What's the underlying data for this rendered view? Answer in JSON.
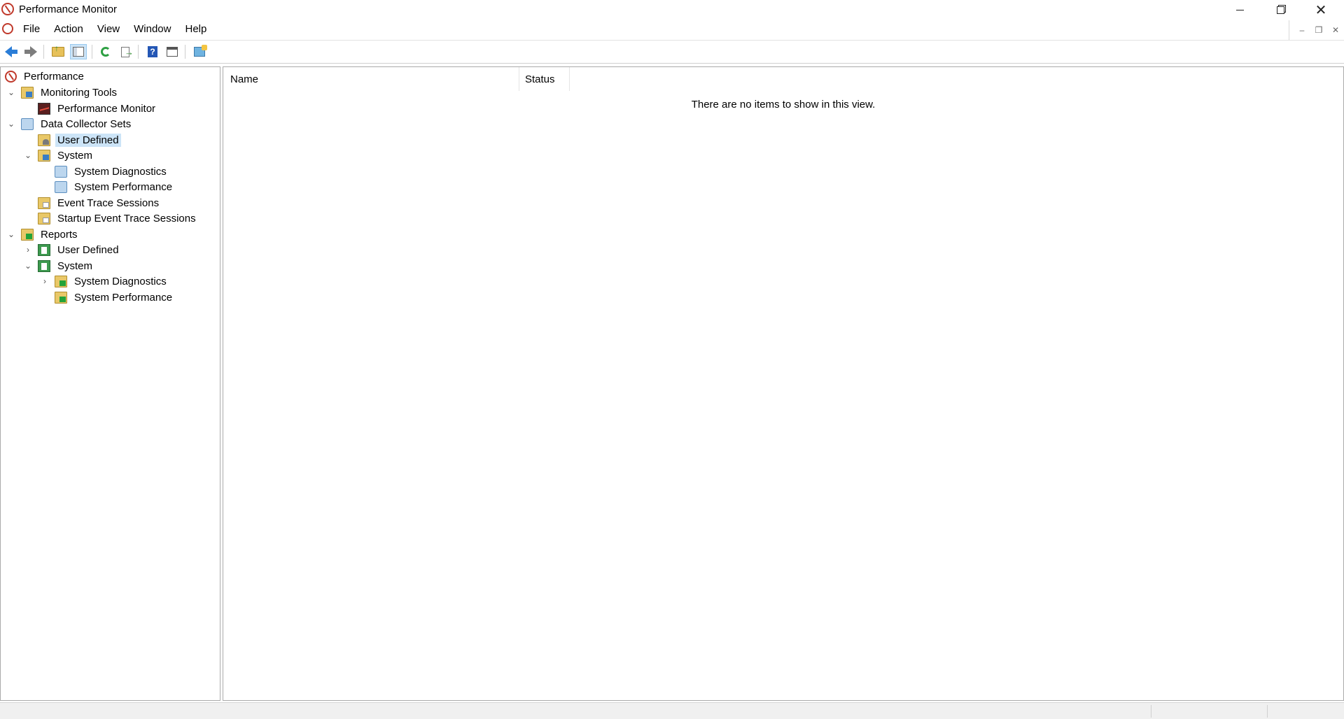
{
  "window": {
    "title": "Performance Monitor",
    "icon": "performance-monitor-icon"
  },
  "menu": {
    "items": [
      "File",
      "Action",
      "View",
      "Window",
      "Help"
    ]
  },
  "toolbar": {
    "buttons": [
      "back-icon",
      "forward-icon",
      "up-one-level-icon",
      "show-hide-console-tree-icon",
      "refresh-icon",
      "export-list-icon",
      "help-icon",
      "show-hide-action-pane-icon",
      "new-window-icon"
    ]
  },
  "tree": {
    "root": "Performance",
    "monitoring_tools": "Monitoring Tools",
    "performance_monitor": "Performance Monitor",
    "data_collector_sets": "Data Collector Sets",
    "dcs_user_defined": "User Defined",
    "dcs_system": "System",
    "dcs_system_diagnostics": "System Diagnostics",
    "dcs_system_performance": "System Performance",
    "event_trace_sessions": "Event Trace Sessions",
    "startup_event_trace_sessions": "Startup Event Trace Sessions",
    "reports": "Reports",
    "reports_user_defined": "User Defined",
    "reports_system": "System",
    "reports_system_diagnostics": "System Diagnostics",
    "reports_system_performance": "System Performance",
    "selected": "User Defined"
  },
  "detail": {
    "columns": [
      "Name",
      "Status"
    ],
    "empty_message": "There are no items to show in this view."
  },
  "colors": {
    "selection": "#cce4f7",
    "border": "#aaaaaa",
    "accent_red": "#c0392b"
  }
}
